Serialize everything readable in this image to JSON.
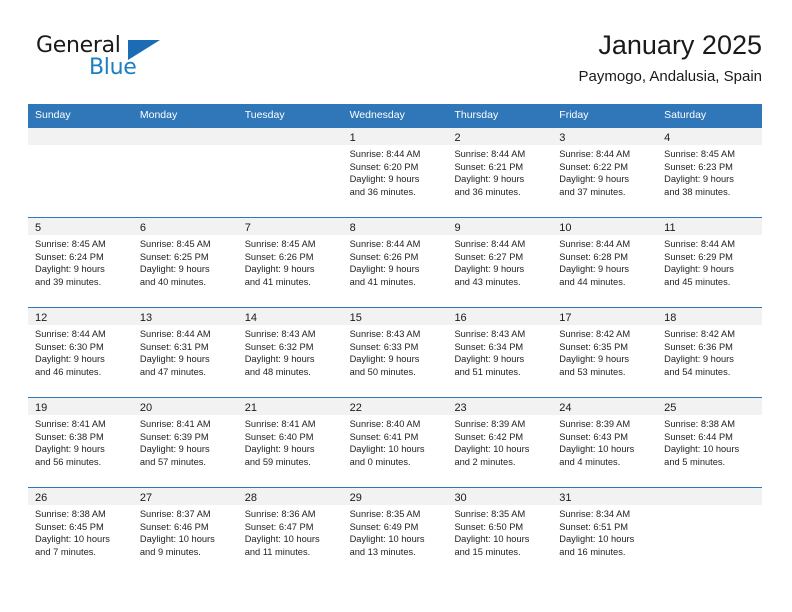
{
  "brand": {
    "name_top": "General",
    "name_bottom": "Blue",
    "accent_color": "#1c7fc4",
    "triangle_color": "#1c6cb5"
  },
  "header": {
    "title": "January 2025",
    "location": "Paymogo, Andalusia, Spain"
  },
  "colors": {
    "header_blue": "#3077b9",
    "daynum_band": "#f2f2f2",
    "text": "#1a1a1a"
  },
  "weekdays": [
    "Sunday",
    "Monday",
    "Tuesday",
    "Wednesday",
    "Thursday",
    "Friday",
    "Saturday"
  ],
  "weeks": [
    [
      {
        "day": "",
        "sunrise": "",
        "sunset": "",
        "daylight_1": "",
        "daylight_2": ""
      },
      {
        "day": "",
        "sunrise": "",
        "sunset": "",
        "daylight_1": "",
        "daylight_2": ""
      },
      {
        "day": "",
        "sunrise": "",
        "sunset": "",
        "daylight_1": "",
        "daylight_2": ""
      },
      {
        "day": "1",
        "sunrise": "Sunrise: 8:44 AM",
        "sunset": "Sunset: 6:20 PM",
        "daylight_1": "Daylight: 9 hours",
        "daylight_2": "and 36 minutes."
      },
      {
        "day": "2",
        "sunrise": "Sunrise: 8:44 AM",
        "sunset": "Sunset: 6:21 PM",
        "daylight_1": "Daylight: 9 hours",
        "daylight_2": "and 36 minutes."
      },
      {
        "day": "3",
        "sunrise": "Sunrise: 8:44 AM",
        "sunset": "Sunset: 6:22 PM",
        "daylight_1": "Daylight: 9 hours",
        "daylight_2": "and 37 minutes."
      },
      {
        "day": "4",
        "sunrise": "Sunrise: 8:45 AM",
        "sunset": "Sunset: 6:23 PM",
        "daylight_1": "Daylight: 9 hours",
        "daylight_2": "and 38 minutes."
      }
    ],
    [
      {
        "day": "5",
        "sunrise": "Sunrise: 8:45 AM",
        "sunset": "Sunset: 6:24 PM",
        "daylight_1": "Daylight: 9 hours",
        "daylight_2": "and 39 minutes."
      },
      {
        "day": "6",
        "sunrise": "Sunrise: 8:45 AM",
        "sunset": "Sunset: 6:25 PM",
        "daylight_1": "Daylight: 9 hours",
        "daylight_2": "and 40 minutes."
      },
      {
        "day": "7",
        "sunrise": "Sunrise: 8:45 AM",
        "sunset": "Sunset: 6:26 PM",
        "daylight_1": "Daylight: 9 hours",
        "daylight_2": "and 41 minutes."
      },
      {
        "day": "8",
        "sunrise": "Sunrise: 8:44 AM",
        "sunset": "Sunset: 6:26 PM",
        "daylight_1": "Daylight: 9 hours",
        "daylight_2": "and 41 minutes."
      },
      {
        "day": "9",
        "sunrise": "Sunrise: 8:44 AM",
        "sunset": "Sunset: 6:27 PM",
        "daylight_1": "Daylight: 9 hours",
        "daylight_2": "and 43 minutes."
      },
      {
        "day": "10",
        "sunrise": "Sunrise: 8:44 AM",
        "sunset": "Sunset: 6:28 PM",
        "daylight_1": "Daylight: 9 hours",
        "daylight_2": "and 44 minutes."
      },
      {
        "day": "11",
        "sunrise": "Sunrise: 8:44 AM",
        "sunset": "Sunset: 6:29 PM",
        "daylight_1": "Daylight: 9 hours",
        "daylight_2": "and 45 minutes."
      }
    ],
    [
      {
        "day": "12",
        "sunrise": "Sunrise: 8:44 AM",
        "sunset": "Sunset: 6:30 PM",
        "daylight_1": "Daylight: 9 hours",
        "daylight_2": "and 46 minutes."
      },
      {
        "day": "13",
        "sunrise": "Sunrise: 8:44 AM",
        "sunset": "Sunset: 6:31 PM",
        "daylight_1": "Daylight: 9 hours",
        "daylight_2": "and 47 minutes."
      },
      {
        "day": "14",
        "sunrise": "Sunrise: 8:43 AM",
        "sunset": "Sunset: 6:32 PM",
        "daylight_1": "Daylight: 9 hours",
        "daylight_2": "and 48 minutes."
      },
      {
        "day": "15",
        "sunrise": "Sunrise: 8:43 AM",
        "sunset": "Sunset: 6:33 PM",
        "daylight_1": "Daylight: 9 hours",
        "daylight_2": "and 50 minutes."
      },
      {
        "day": "16",
        "sunrise": "Sunrise: 8:43 AM",
        "sunset": "Sunset: 6:34 PM",
        "daylight_1": "Daylight: 9 hours",
        "daylight_2": "and 51 minutes."
      },
      {
        "day": "17",
        "sunrise": "Sunrise: 8:42 AM",
        "sunset": "Sunset: 6:35 PM",
        "daylight_1": "Daylight: 9 hours",
        "daylight_2": "and 53 minutes."
      },
      {
        "day": "18",
        "sunrise": "Sunrise: 8:42 AM",
        "sunset": "Sunset: 6:36 PM",
        "daylight_1": "Daylight: 9 hours",
        "daylight_2": "and 54 minutes."
      }
    ],
    [
      {
        "day": "19",
        "sunrise": "Sunrise: 8:41 AM",
        "sunset": "Sunset: 6:38 PM",
        "daylight_1": "Daylight: 9 hours",
        "daylight_2": "and 56 minutes."
      },
      {
        "day": "20",
        "sunrise": "Sunrise: 8:41 AM",
        "sunset": "Sunset: 6:39 PM",
        "daylight_1": "Daylight: 9 hours",
        "daylight_2": "and 57 minutes."
      },
      {
        "day": "21",
        "sunrise": "Sunrise: 8:41 AM",
        "sunset": "Sunset: 6:40 PM",
        "daylight_1": "Daylight: 9 hours",
        "daylight_2": "and 59 minutes."
      },
      {
        "day": "22",
        "sunrise": "Sunrise: 8:40 AM",
        "sunset": "Sunset: 6:41 PM",
        "daylight_1": "Daylight: 10 hours",
        "daylight_2": "and 0 minutes."
      },
      {
        "day": "23",
        "sunrise": "Sunrise: 8:39 AM",
        "sunset": "Sunset: 6:42 PM",
        "daylight_1": "Daylight: 10 hours",
        "daylight_2": "and 2 minutes."
      },
      {
        "day": "24",
        "sunrise": "Sunrise: 8:39 AM",
        "sunset": "Sunset: 6:43 PM",
        "daylight_1": "Daylight: 10 hours",
        "daylight_2": "and 4 minutes."
      },
      {
        "day": "25",
        "sunrise": "Sunrise: 8:38 AM",
        "sunset": "Sunset: 6:44 PM",
        "daylight_1": "Daylight: 10 hours",
        "daylight_2": "and 5 minutes."
      }
    ],
    [
      {
        "day": "26",
        "sunrise": "Sunrise: 8:38 AM",
        "sunset": "Sunset: 6:45 PM",
        "daylight_1": "Daylight: 10 hours",
        "daylight_2": "and 7 minutes."
      },
      {
        "day": "27",
        "sunrise": "Sunrise: 8:37 AM",
        "sunset": "Sunset: 6:46 PM",
        "daylight_1": "Daylight: 10 hours",
        "daylight_2": "and 9 minutes."
      },
      {
        "day": "28",
        "sunrise": "Sunrise: 8:36 AM",
        "sunset": "Sunset: 6:47 PM",
        "daylight_1": "Daylight: 10 hours",
        "daylight_2": "and 11 minutes."
      },
      {
        "day": "29",
        "sunrise": "Sunrise: 8:35 AM",
        "sunset": "Sunset: 6:49 PM",
        "daylight_1": "Daylight: 10 hours",
        "daylight_2": "and 13 minutes."
      },
      {
        "day": "30",
        "sunrise": "Sunrise: 8:35 AM",
        "sunset": "Sunset: 6:50 PM",
        "daylight_1": "Daylight: 10 hours",
        "daylight_2": "and 15 minutes."
      },
      {
        "day": "31",
        "sunrise": "Sunrise: 8:34 AM",
        "sunset": "Sunset: 6:51 PM",
        "daylight_1": "Daylight: 10 hours",
        "daylight_2": "and 16 minutes."
      },
      {
        "day": "",
        "sunrise": "",
        "sunset": "",
        "daylight_1": "",
        "daylight_2": ""
      }
    ]
  ]
}
